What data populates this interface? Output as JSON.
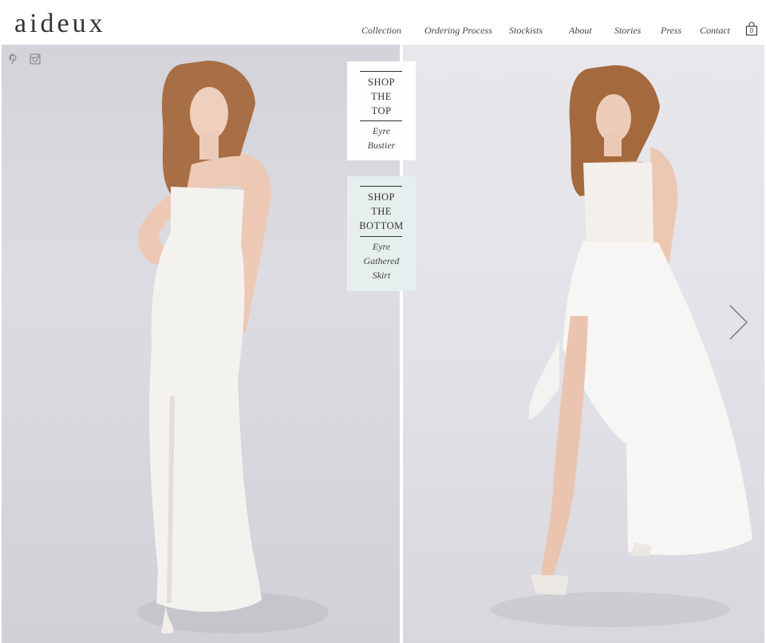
{
  "brand": {
    "logo": "aideux"
  },
  "nav": {
    "items": [
      {
        "label": "Collection"
      },
      {
        "label": "Ordering Process"
      },
      {
        "label": "Stockists"
      },
      {
        "label": "About"
      },
      {
        "label": "Stories"
      },
      {
        "label": "Press"
      },
      {
        "label": "Contact"
      }
    ],
    "cart_count": "0"
  },
  "social": {
    "icons": [
      "pinterest-icon",
      "instagram-icon"
    ]
  },
  "shop_top": {
    "heading": [
      "SHOP",
      "THE",
      "TOP"
    ],
    "item": [
      "Eyre",
      "Bustier"
    ]
  },
  "shop_bottom": {
    "heading": [
      "SHOP",
      "THE",
      "BOTTOM"
    ],
    "item": [
      "Eyre",
      "Gathered",
      "Skirt"
    ]
  },
  "colors": {
    "shop_top_bg": "#fffdfd",
    "shop_bottom_bg": "#e6efee",
    "text": "#333333",
    "backdrop": "#d8d8de"
  },
  "icons": {
    "next": "chevron-right-icon",
    "cart": "shopping-bag-icon"
  }
}
